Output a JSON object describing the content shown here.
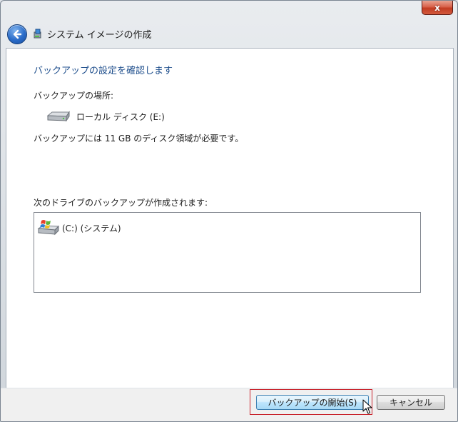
{
  "window": {
    "title": "システム イメージの作成",
    "close_label": "x"
  },
  "content": {
    "heading": "バックアップの設定を確認します",
    "location_label": "バックアップの場所:",
    "drive_name": "ローカル ディスク (E:)",
    "space_required": "バックアップには 11 GB のディスク領域が必要です。",
    "drives_label": "次のドライブのバックアップが作成されます:",
    "drives": [
      {
        "label": "(C:) (システム)",
        "icon": "windows-drive-icon"
      }
    ]
  },
  "footer": {
    "start_button": "バックアップの開始(S)",
    "cancel_button": "キャンセル"
  },
  "icons": {
    "back": "back-arrow-icon",
    "app": "system-image-icon",
    "drive": "hard-drive-icon",
    "cursor": "mouse-pointer-icon"
  },
  "colors": {
    "heading": "#1e4e8c",
    "close_button": "#c23c22",
    "highlight_box": "#c8232c",
    "primary_button": "#bee6fd"
  }
}
